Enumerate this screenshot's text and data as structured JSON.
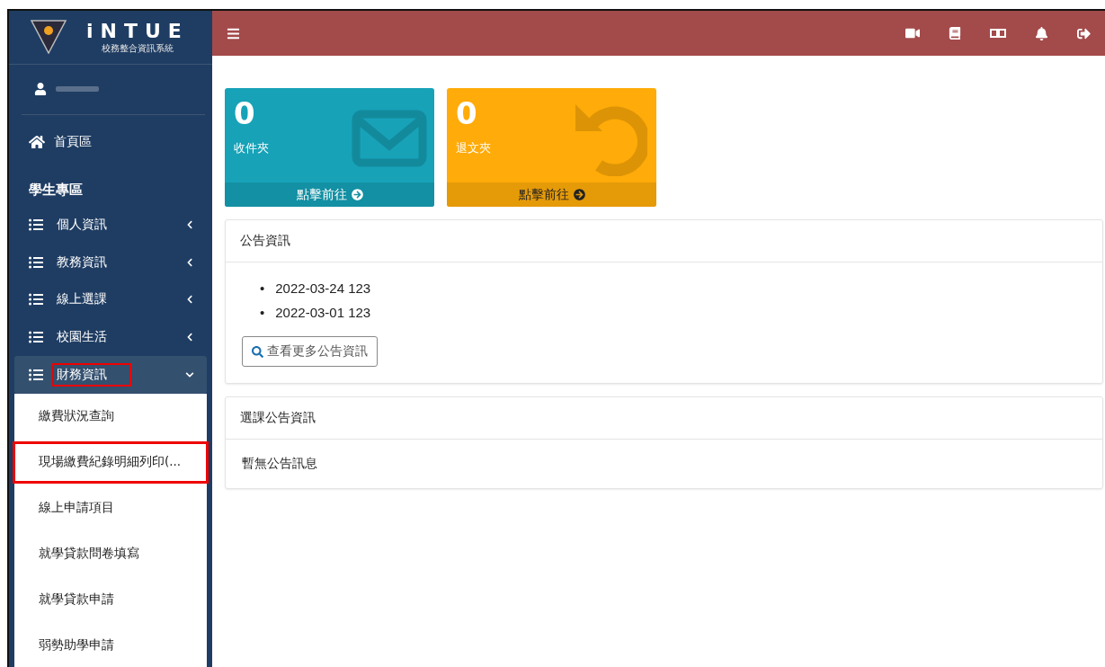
{
  "brand": {
    "name": "iNTUE",
    "subtitle": "校務整合資訊系統"
  },
  "sidebar": {
    "home": "首頁區",
    "section": "學生專區",
    "items": [
      {
        "label": "個人資訊",
        "expanded": false,
        "highlighted": false
      },
      {
        "label": "教務資訊",
        "expanded": false,
        "highlighted": false
      },
      {
        "label": "線上選課",
        "expanded": false,
        "highlighted": false
      },
      {
        "label": "校園生活",
        "expanded": false,
        "highlighted": false
      },
      {
        "label": "財務資訊",
        "expanded": true,
        "highlighted": true,
        "children": [
          {
            "label": "繳費狀況查詢",
            "highlighted": false
          },
          {
            "label": "現場繳費紀錄明細列印(...",
            "highlighted": true
          },
          {
            "label": "線上申請項目",
            "highlighted": false
          },
          {
            "label": "就學貸款問卷填寫",
            "highlighted": false
          },
          {
            "label": "就學貸款申請",
            "highlighted": false
          },
          {
            "label": "弱勢助學申請",
            "highlighted": false
          }
        ]
      }
    ]
  },
  "cards": [
    {
      "kind": "mail",
      "count": "0",
      "label": "收件夾",
      "link": "點擊前往"
    },
    {
      "kind": "return",
      "count": "0",
      "label": "退文夾",
      "link": "點擊前往"
    }
  ],
  "announcements": {
    "title": "公告資訊",
    "items": [
      {
        "bullet": "•",
        "text": "2022-03-24 123"
      },
      {
        "bullet": "•",
        "text": "2022-03-01 123"
      }
    ],
    "more": "查看更多公告資訊"
  },
  "course_announcements": {
    "title": "選課公告資訊",
    "empty": "暫無公告訊息"
  }
}
